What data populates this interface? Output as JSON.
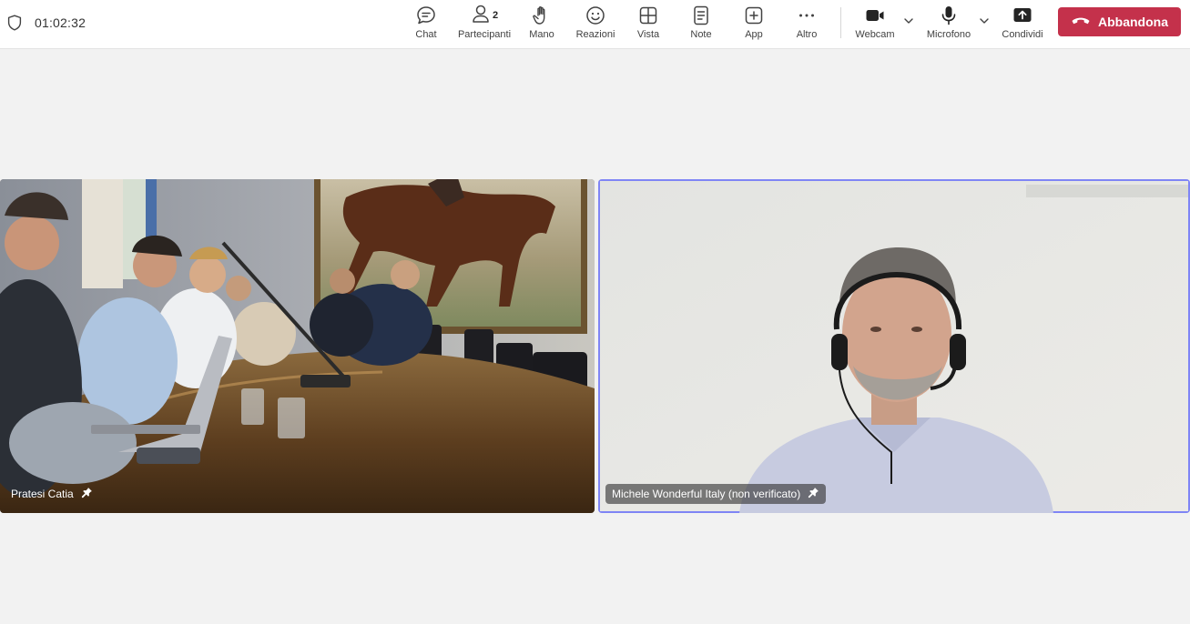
{
  "meeting": {
    "elapsed_time": "01:02:32"
  },
  "toolbar": {
    "chat_label": "Chat",
    "participants_label": "Partecipanti",
    "participants_count": "2",
    "raise_hand_label": "Mano",
    "reactions_label": "Reazioni",
    "view_label": "Vista",
    "notes_label": "Note",
    "apps_label": "App",
    "more_label": "Altro",
    "camera_label": "Webcam",
    "mic_label": "Microfono",
    "share_label": "Condividi",
    "leave_label": "Abbandona"
  },
  "icons": {
    "shield": "shield-icon",
    "chat": "chat-icon",
    "participants": "people-icon",
    "hand": "hand-icon",
    "reactions": "smiley-icon",
    "view": "grid-icon",
    "notes": "notes-icon",
    "apps": "plus-square-icon",
    "more": "ellipsis-icon",
    "camera": "video-camera-icon",
    "mic": "microphone-icon",
    "share": "share-tray-icon",
    "leave": "phone-hangup-icon",
    "pin": "pin-icon"
  },
  "colors": {
    "leave_button": "#c4314b",
    "active_speaker_border": "#7f85f5",
    "stage_background": "#f2f2f2"
  },
  "participants": [
    {
      "name": "Pratesi Catia"
    },
    {
      "name": "Michele Wonderful Italy (non verificato)"
    }
  ]
}
